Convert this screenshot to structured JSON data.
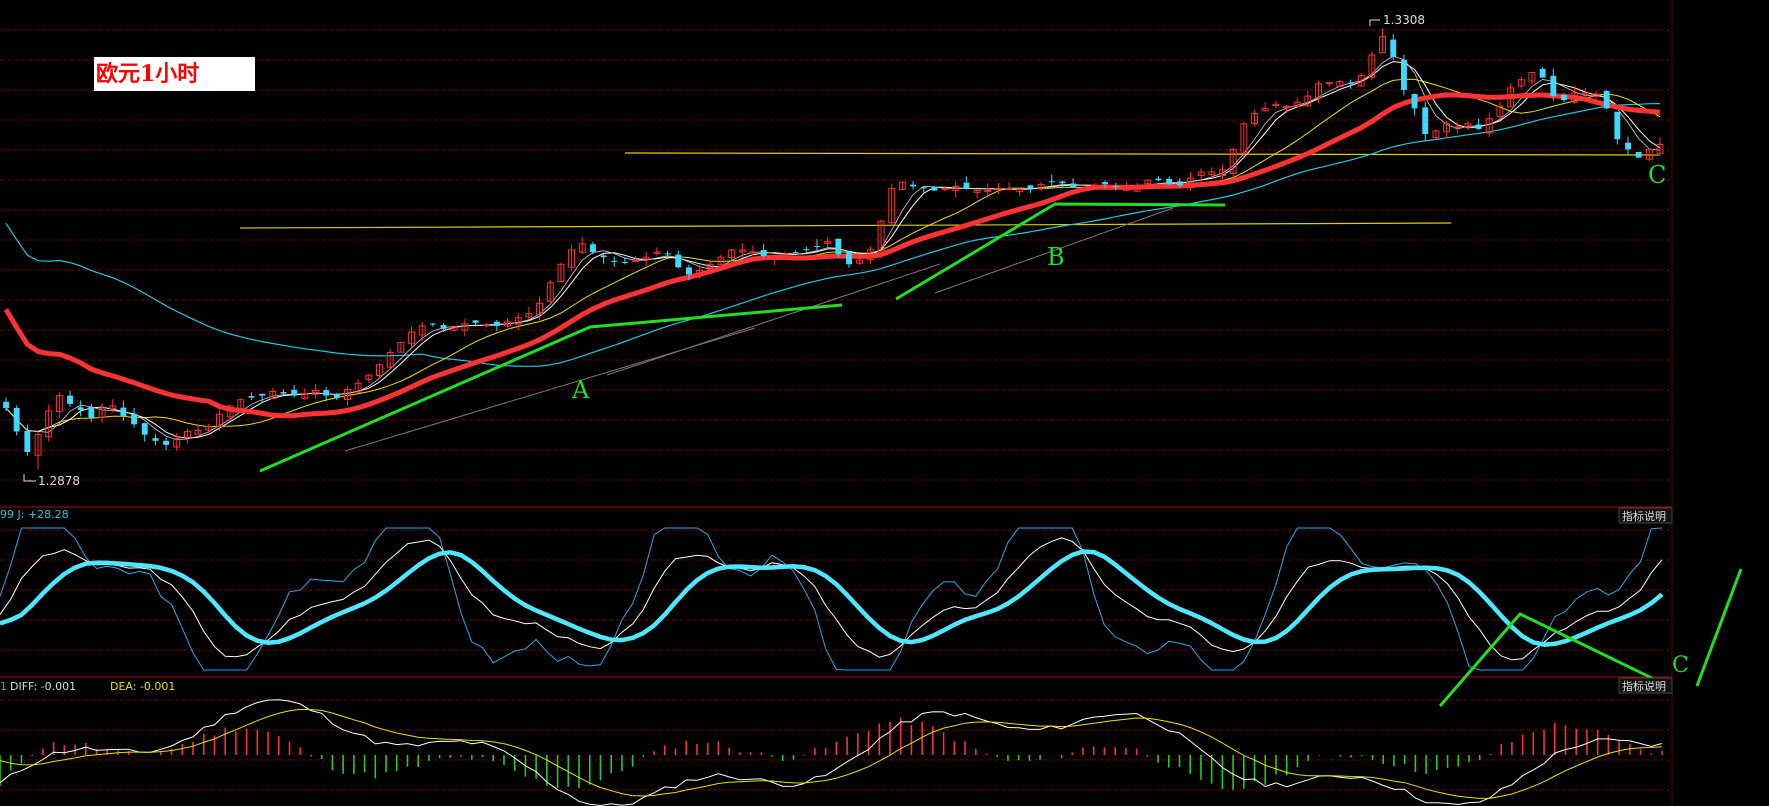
{
  "title": "欧元1小时",
  "colors": {
    "background": "#000000",
    "grid": "#7a0000",
    "candle_up": "#ff3030",
    "candle_down": "#40d8ff",
    "ma_thick": "#ff3333",
    "ma_cyan": "#22c6e0",
    "ma_white": "#ffffff",
    "ma_yellow": "#e8e000",
    "kdj_thick": "#4fe6ff",
    "kdj_thin": "#2aa8e8",
    "annotation": "#22dd22",
    "support_line": "#d8d000"
  },
  "chart_data": [
    {
      "type": "candlestick",
      "panel": "price",
      "title": "欧元1小时",
      "high_label": "1.3308",
      "low_label": "1.2878",
      "ylim": [
        1.2858,
        1.3322
      ],
      "annotations": [
        "A",
        "B",
        "C"
      ],
      "grid": true,
      "close": [
        1.2938,
        1.2915,
        1.2895,
        1.2912,
        1.2935,
        1.295,
        1.2942,
        1.2936,
        1.2928,
        1.2938,
        1.294,
        1.293,
        1.2922,
        1.2912,
        1.2906,
        1.2902,
        1.2908,
        1.2915,
        1.2916,
        1.292,
        1.2932,
        1.294,
        1.2946,
        1.2948,
        1.295,
        1.2954,
        1.2952,
        1.295,
        1.2952,
        1.2955,
        1.295,
        1.2948,
        1.2956,
        1.2962,
        1.297,
        1.298,
        1.2992,
        1.3002,
        1.3012,
        1.3018,
        1.302,
        1.3015,
        1.3017,
        1.302,
        1.3021,
        1.3019,
        1.3018,
        1.3022,
        1.3026,
        1.303,
        1.304,
        1.306,
        1.3078,
        1.3092,
        1.3098,
        1.309,
        1.3085,
        1.3081,
        1.308,
        1.3082,
        1.3085,
        1.309,
        1.3088,
        1.3075,
        1.3068,
        1.3072,
        1.3078,
        1.3085,
        1.3092,
        1.3092,
        1.309,
        1.3086,
        1.3086,
        1.3088,
        1.309,
        1.3092,
        1.3095,
        1.31,
        1.3088,
        1.3078,
        1.3082,
        1.3092,
        1.312,
        1.3152,
        1.3158,
        1.3154,
        1.3152,
        1.315,
        1.3152,
        1.3154,
        1.3152,
        1.315,
        1.315,
        1.3152,
        1.3152,
        1.3151,
        1.3152,
        1.3156,
        1.3158,
        1.3157,
        1.3153,
        1.3152,
        1.3155,
        1.3156,
        1.3154,
        1.3152,
        1.3155,
        1.316,
        1.316,
        1.3156,
        1.3155,
        1.3162,
        1.3168,
        1.3168,
        1.317,
        1.319,
        1.3215,
        1.3225,
        1.323,
        1.3234,
        1.3232,
        1.3236,
        1.3242,
        1.3254,
        1.3255,
        1.3256,
        1.3254,
        1.3262,
        1.3282,
        1.33,
        1.328,
        1.3248,
        1.323,
        1.3205,
        1.3208,
        1.3215,
        1.3212,
        1.3215,
        1.321,
        1.322,
        1.3232,
        1.325,
        1.3258,
        1.3265,
        1.326,
        1.3242,
        1.3238,
        1.3245,
        1.3245,
        1.3244,
        1.323,
        1.32,
        1.319,
        1.3182,
        1.319,
        1.3195
      ]
    },
    {
      "type": "line",
      "panel": "kdj",
      "label": "99 J: +28.28",
      "button": "指标说明",
      "annotations": [
        "C"
      ]
    },
    {
      "type": "bar",
      "panel": "macd",
      "label_prefix": "1",
      "diff_label": "DIFF: -0.001",
      "dea_label": "DEA: -0.001",
      "button": "指标说明"
    }
  ]
}
